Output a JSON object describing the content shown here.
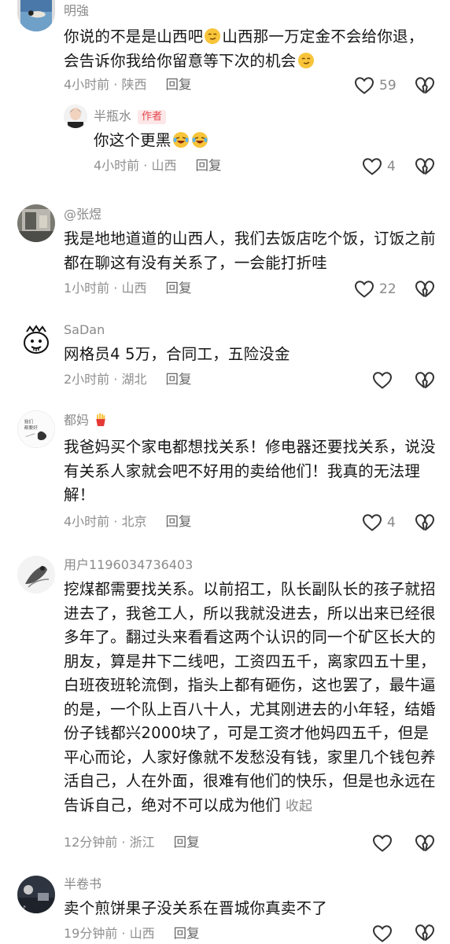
{
  "comments": [
    {
      "username": "明強",
      "lines": [
        "你说的不是是山西吧",
        "会告诉你我给你留意等下次的机会"
      ],
      "line1_tail": "山西那一万定金不会给你退，",
      "time": "4小时前 · 陕西",
      "reply_label": "回复",
      "likes": "59",
      "replies": [
        {
          "username": "半瓶水",
          "badge": "作者",
          "text": "你这个更黑",
          "time": "4小时前 · 山西",
          "reply_label": "回复",
          "likes": "4"
        }
      ]
    },
    {
      "username": "@张煜",
      "lines": [
        "我是地地道道的山西人，我们去饭店吃个饭，订饭之前",
        "都在聊这有没有关系了，一会能打折哇"
      ],
      "time": "1小时前 · 山西",
      "reply_label": "回复",
      "likes": "22"
    },
    {
      "username": "SaDan",
      "lines": [
        "网格员4 5万，合同工，五险没金"
      ],
      "time": "2小时前 · 湖北",
      "reply_label": "回复",
      "likes": ""
    },
    {
      "username": "都妈",
      "lines": [
        "我爸妈买个家电都想找关系！修电器还要找关系，说没",
        "有关系人家就会吧不好用的卖给他们！我真的无法理",
        "解！"
      ],
      "time": "4小时前 · 北京",
      "reply_label": "回复",
      "likes": "4"
    },
    {
      "username": "用户1196034736403",
      "lines": [
        "挖煤都需要找关系。以前招工，队长副队长的孩子就招",
        "进去了，我爸工人，所以我就没进去，所以出来已经很",
        "多年了。翻过头来看看这两个认识的同一个矿区长大的",
        "朋友，算是井下二线吧，工资四五千，离家四五十里，",
        "白班夜班轮流倒，指头上都有砸伤，这也罢了，最牛逼",
        "的是，一个队上百八十人，尤其刚进去的小年轻，结婚",
        "份子钱都兴2000块了，可是工资才他妈四五千，但是",
        "平心而论，人家好像就不发愁没有钱，家里几个钱包养",
        "活自己，人在外面，很难有他们的快乐，但是也永远在",
        "告诉自己，绝对不可以成为他们"
      ],
      "collapse_label": "收起",
      "time": "12分钟前 · 浙江",
      "reply_label": "回复",
      "likes": ""
    },
    {
      "username": "半卷书",
      "lines": [
        "卖个煎饼果子没关系在晋城你真卖不了"
      ],
      "time": "19分钟前 · 山西",
      "reply_label": "回复",
      "likes": ""
    }
  ],
  "colors": {
    "text": "#161616",
    "meta": "#8f8f8f",
    "badge_text": "#e5464c",
    "badge_bg": "#fde7e8"
  },
  "icons": [
    "heart-outline-icon",
    "broken-heart-icon",
    "smirk-emoji-icon",
    "laugh-cry-emoji-icon",
    "fries-emoji-icon"
  ]
}
